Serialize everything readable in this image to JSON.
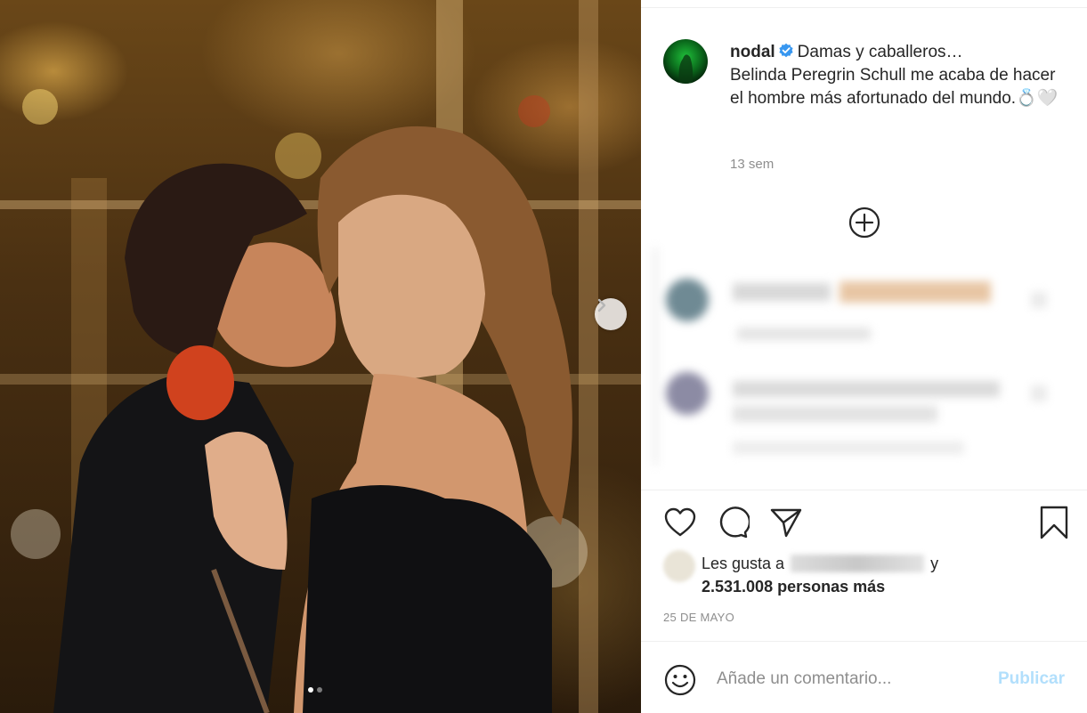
{
  "post": {
    "username": "nodal",
    "caption_line1": "Damas y caballeros…",
    "caption_rest": "Belinda Peregrin Schull me acaba de hacer el hombre más afortunado del mundo.💍🤍",
    "time_ago": "13 sem",
    "date": "25 DE MAYO"
  },
  "media": {
    "carousel_total": 2,
    "carousel_active": 1
  },
  "likes": {
    "prefix": "Les gusta a",
    "suffix": "y",
    "count_text": "2.531.008 personas más"
  },
  "comment_box": {
    "placeholder": "Añade un comentario...",
    "publish_label": "Publicar"
  },
  "icons": {
    "verified": "verified-badge-icon",
    "next": "chevron-right-icon",
    "add": "plus-circle-icon",
    "like": "heart-icon",
    "comment": "comment-bubble-icon",
    "share": "paper-plane-icon",
    "save": "bookmark-icon",
    "emoji": "smiley-icon"
  },
  "colors": {
    "verified_blue": "#3897f0",
    "publish_disabled": "#b2dffc",
    "muted_text": "#8e8e8e"
  }
}
